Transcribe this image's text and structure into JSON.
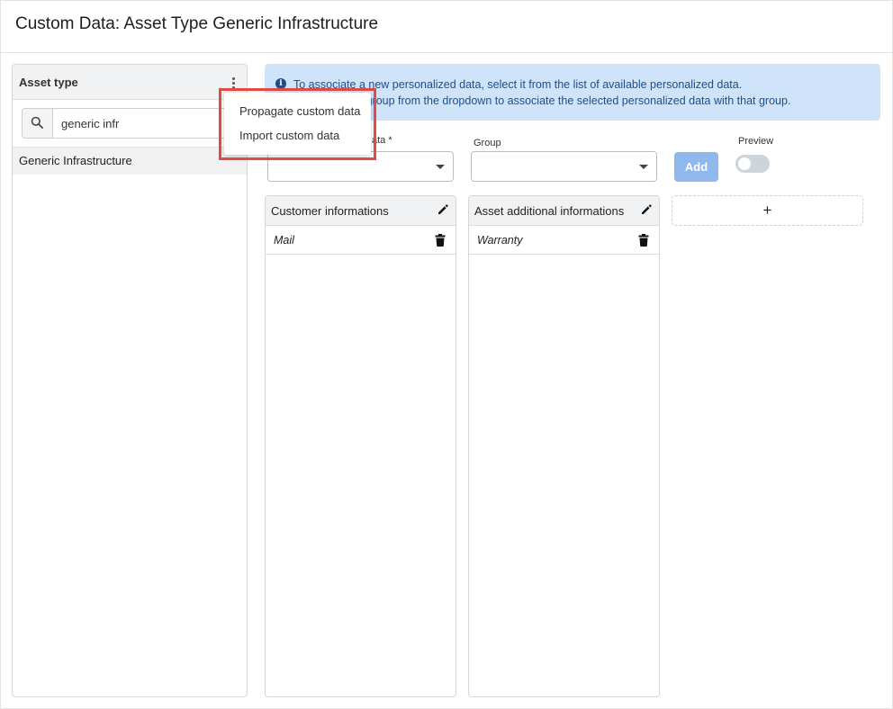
{
  "header": {
    "title": "Custom Data: Asset Type Generic Infrastructure"
  },
  "left_panel": {
    "title": "Asset type",
    "search": {
      "value": "generic infr",
      "icon": "search-icon"
    },
    "items": [
      "Generic Infrastructure"
    ]
  },
  "context_menu": {
    "items": [
      "Propagate custom data",
      "Import custom data"
    ],
    "highlight_color": "#e04c45"
  },
  "info_banner": {
    "line1": "To associate a new personalized data, select it from the list of available personalized data.",
    "line2": "u can select a group from the dropdown to associate the selected personalized data with that group.",
    "color": "#cfe4fb"
  },
  "form": {
    "data_label_visible": "ata *",
    "data_value": "",
    "group_label": "Group",
    "group_value": "",
    "add_label": "Add",
    "preview_label": "Preview",
    "preview_on": false,
    "accent": "#8fb9ec"
  },
  "groups": [
    {
      "title": "Customer informations",
      "items": [
        "Mail"
      ]
    },
    {
      "title": "Asset additional informations",
      "items": [
        "Warranty"
      ]
    }
  ],
  "add_group_label": "+"
}
